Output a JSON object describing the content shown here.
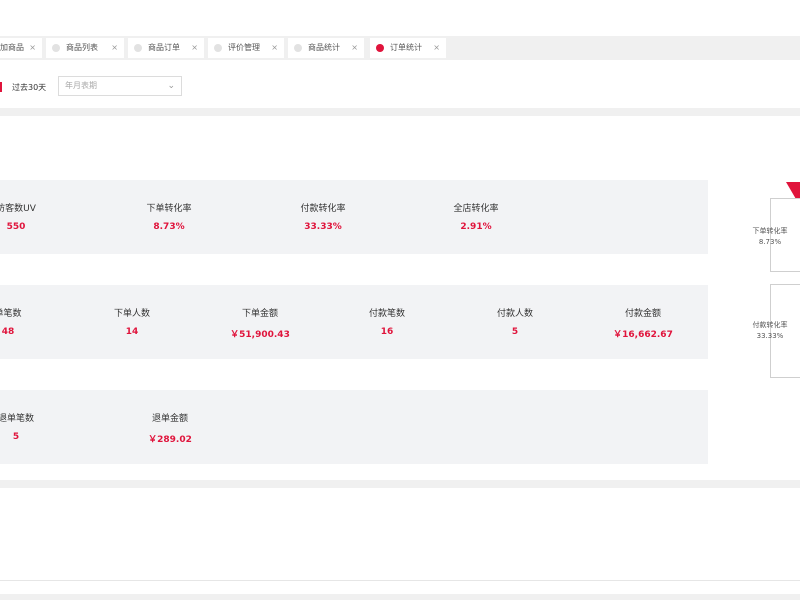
{
  "tabs": [
    {
      "label": "加商品",
      "active": false
    },
    {
      "label": "商品列表",
      "active": false
    },
    {
      "label": "商品订单",
      "active": false
    },
    {
      "label": "评价管理",
      "active": false
    },
    {
      "label": "商品统计",
      "active": false
    },
    {
      "label": "订单统计",
      "active": true
    }
  ],
  "tab_close": "×",
  "filter": {
    "range_label": "过去30天",
    "date_placeholder": "年月表期",
    "chevron": "⌄"
  },
  "panels": {
    "conversion": [
      {
        "label": "访客数UV",
        "value": "550"
      },
      {
        "label": "下单转化率",
        "value": "8.73%"
      },
      {
        "label": "付款转化率",
        "value": "33.33%"
      },
      {
        "label": "全店转化率",
        "value": "2.91%"
      }
    ],
    "orders": [
      {
        "label": "单笔数",
        "value": "48"
      },
      {
        "label": "下单人数",
        "value": "14"
      },
      {
        "label": "下单金额",
        "value": "￥51,900.43"
      },
      {
        "label": "付款笔数",
        "value": "16"
      },
      {
        "label": "付款人数",
        "value": "5"
      },
      {
        "label": "付款金额",
        "value": "￥16,662.67"
      }
    ],
    "refunds": [
      {
        "label": "退单笔数",
        "value": "5"
      },
      {
        "label": "退单金额",
        "value": "￥289.02"
      }
    ]
  },
  "funnel": {
    "order_rate_label": "下单转化率",
    "order_rate_value": "8.73%",
    "pay_rate_label": "付款转化率",
    "pay_rate_value": "33.33%",
    "color": "#e0143c"
  },
  "colors": {
    "accent": "#e0143c",
    "panel_bg": "#f2f3f5"
  }
}
